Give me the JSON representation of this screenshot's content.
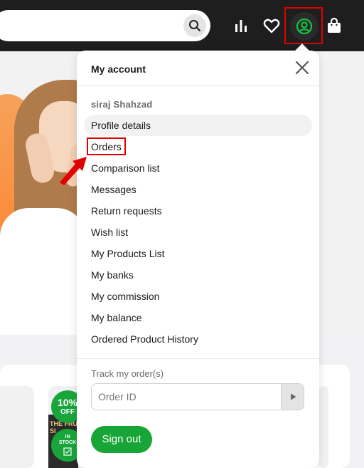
{
  "colors": {
    "topbar": "#1e1e1e",
    "accent": "#16a536",
    "highlight": "#e00000"
  },
  "header": {
    "icons": [
      "search-icon",
      "compare-chart-icon",
      "heart-icon",
      "account-icon",
      "shopping-bag-icon"
    ]
  },
  "dropdown": {
    "title": "My account",
    "close_icon": "close-icon",
    "user_name": "siraj Shahzad",
    "items": [
      {
        "label": "Profile details"
      },
      {
        "label": "Orders"
      },
      {
        "label": "Comparison list"
      },
      {
        "label": "Messages"
      },
      {
        "label": "Return requests"
      },
      {
        "label": "Wish list"
      },
      {
        "label": "My Products List"
      },
      {
        "label": "My banks"
      },
      {
        "label": "My commission"
      },
      {
        "label": "My balance"
      },
      {
        "label": "Ordered Product History"
      }
    ],
    "track": {
      "label": "Track my order(s)",
      "placeholder": "Order ID",
      "value": ""
    },
    "sign_out": "Sign out"
  },
  "product": {
    "discount_value": "10%",
    "discount_label": "OFF",
    "stock_line1": "IN",
    "stock_line2": "STOCK",
    "book_title_line1": "THE FRU",
    "book_title_line2": "SI"
  }
}
